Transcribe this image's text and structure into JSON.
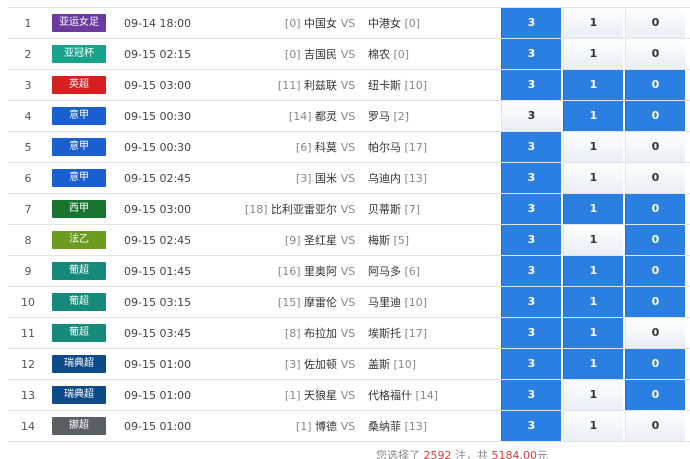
{
  "vs_label": "VS",
  "colors": {
    "selected": "#2b7fe0",
    "unselected": "#eef3f9",
    "count_highlight": "#e03b3b"
  },
  "matches": [
    {
      "idx": "1",
      "league": "亚运女足",
      "league_color": "#6b3aa0",
      "time": "09-14 18:00",
      "home_rank": "[0]",
      "home": "中国女",
      "away": "中港女",
      "away_rank": "[0]",
      "opts": [
        {
          "label": "3",
          "selected": true
        },
        {
          "label": "1",
          "selected": false
        },
        {
          "label": "0",
          "selected": false
        }
      ]
    },
    {
      "idx": "2",
      "league": "亚冠杯",
      "league_color": "#17a389",
      "time": "09-15 02:15",
      "home_rank": "[0]",
      "home": "吉国民",
      "away": "棉农",
      "away_rank": "[0]",
      "opts": [
        {
          "label": "3",
          "selected": true
        },
        {
          "label": "1",
          "selected": false
        },
        {
          "label": "0",
          "selected": false
        }
      ]
    },
    {
      "idx": "3",
      "league": "英超",
      "league_color": "#d61f1f",
      "time": "09-15 03:00",
      "home_rank": "[11]",
      "home": "利兹联",
      "away": "纽卡斯",
      "away_rank": "[10]",
      "opts": [
        {
          "label": "3",
          "selected": true
        },
        {
          "label": "1",
          "selected": true
        },
        {
          "label": "0",
          "selected": true
        }
      ]
    },
    {
      "idx": "4",
      "league": "意甲",
      "league_color": "#1a5fd1",
      "time": "09-15 00:30",
      "home_rank": "[14]",
      "home": "都灵",
      "away": "罗马",
      "away_rank": "[2]",
      "opts": [
        {
          "label": "3",
          "selected": false
        },
        {
          "label": "1",
          "selected": true
        },
        {
          "label": "0",
          "selected": true
        }
      ]
    },
    {
      "idx": "5",
      "league": "意甲",
      "league_color": "#1a5fd1",
      "time": "09-15 00:30",
      "home_rank": "[6]",
      "home": "科莫",
      "away": "帕尔马",
      "away_rank": "[17]",
      "opts": [
        {
          "label": "3",
          "selected": true
        },
        {
          "label": "1",
          "selected": false
        },
        {
          "label": "0",
          "selected": false
        }
      ]
    },
    {
      "idx": "6",
      "league": "意甲",
      "league_color": "#1a5fd1",
      "time": "09-15 02:45",
      "home_rank": "[3]",
      "home": "国米",
      "away": "乌迪内",
      "away_rank": "[13]",
      "opts": [
        {
          "label": "3",
          "selected": true
        },
        {
          "label": "1",
          "selected": false
        },
        {
          "label": "0",
          "selected": false
        }
      ]
    },
    {
      "idx": "7",
      "league": "西甲",
      "league_color": "#187530",
      "time": "09-15 03:00",
      "home_rank": "[18]",
      "home": "比利亚雷亚尔",
      "away": "贝蒂斯",
      "away_rank": "[7]",
      "opts": [
        {
          "label": "3",
          "selected": true
        },
        {
          "label": "1",
          "selected": true
        },
        {
          "label": "0",
          "selected": true
        }
      ]
    },
    {
      "idx": "8",
      "league": "法乙",
      "league_color": "#6b9b1f",
      "time": "09-15 02:45",
      "home_rank": "[9]",
      "home": "圣红星",
      "away": "梅斯",
      "away_rank": "[5]",
      "opts": [
        {
          "label": "3",
          "selected": true
        },
        {
          "label": "1",
          "selected": false
        },
        {
          "label": "0",
          "selected": true
        }
      ]
    },
    {
      "idx": "9",
      "league": "葡超",
      "league_color": "#148a7a",
      "time": "09-15 01:45",
      "home_rank": "[16]",
      "home": "里奥阿",
      "away": "阿马多",
      "away_rank": "[6]",
      "opts": [
        {
          "label": "3",
          "selected": true
        },
        {
          "label": "1",
          "selected": true
        },
        {
          "label": "0",
          "selected": true
        }
      ]
    },
    {
      "idx": "10",
      "league": "葡超",
      "league_color": "#148a7a",
      "time": "09-15 03:15",
      "home_rank": "[15]",
      "home": "摩雷伦",
      "away": "马里迪",
      "away_rank": "[10]",
      "opts": [
        {
          "label": "3",
          "selected": true
        },
        {
          "label": "1",
          "selected": true
        },
        {
          "label": "0",
          "selected": true
        }
      ]
    },
    {
      "idx": "11",
      "league": "葡超",
      "league_color": "#148a7a",
      "time": "09-15 03:45",
      "home_rank": "[8]",
      "home": "布拉加",
      "away": "埃斯托",
      "away_rank": "[17]",
      "opts": [
        {
          "label": "3",
          "selected": true
        },
        {
          "label": "1",
          "selected": true
        },
        {
          "label": "0",
          "selected": false
        }
      ]
    },
    {
      "idx": "12",
      "league": "瑞典超",
      "league_color": "#0d4a8a",
      "time": "09-15 01:00",
      "home_rank": "[3]",
      "home": "佐加顿",
      "away": "盖斯",
      "away_rank": "[10]",
      "opts": [
        {
          "label": "3",
          "selected": true
        },
        {
          "label": "1",
          "selected": true
        },
        {
          "label": "0",
          "selected": true
        }
      ]
    },
    {
      "idx": "13",
      "league": "瑞典超",
      "league_color": "#0d4a8a",
      "time": "09-15 01:00",
      "home_rank": "[1]",
      "home": "天狼星",
      "away": "代格福什",
      "away_rank": "[14]",
      "opts": [
        {
          "label": "3",
          "selected": true
        },
        {
          "label": "1",
          "selected": false
        },
        {
          "label": "0",
          "selected": true
        }
      ]
    },
    {
      "idx": "14",
      "league": "挪超",
      "league_color": "#5a5f66",
      "time": "09-15 01:00",
      "home_rank": "[1]",
      "home": "博德",
      "away": "桑纳菲",
      "away_rank": "[13]",
      "opts": [
        {
          "label": "3",
          "selected": true
        },
        {
          "label": "1",
          "selected": false
        },
        {
          "label": "0",
          "selected": false
        }
      ]
    }
  ],
  "footer": {
    "prefix": "您选择了",
    "count": "2592",
    "middle": "注，共",
    "amount": "5184.00",
    "suffix": "元"
  }
}
